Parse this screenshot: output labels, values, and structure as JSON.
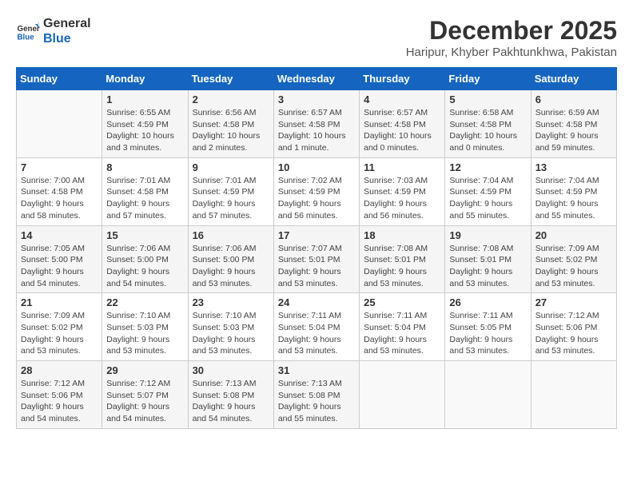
{
  "header": {
    "logo_line1": "General",
    "logo_line2": "Blue",
    "month_title": "December 2025",
    "location": "Haripur, Khyber Pakhtunkhwa, Pakistan"
  },
  "days_of_week": [
    "Sunday",
    "Monday",
    "Tuesday",
    "Wednesday",
    "Thursday",
    "Friday",
    "Saturday"
  ],
  "weeks": [
    [
      {
        "day": "",
        "detail": ""
      },
      {
        "day": "1",
        "detail": "Sunrise: 6:55 AM\nSunset: 4:59 PM\nDaylight: 10 hours\nand 3 minutes."
      },
      {
        "day": "2",
        "detail": "Sunrise: 6:56 AM\nSunset: 4:58 PM\nDaylight: 10 hours\nand 2 minutes."
      },
      {
        "day": "3",
        "detail": "Sunrise: 6:57 AM\nSunset: 4:58 PM\nDaylight: 10 hours\nand 1 minute."
      },
      {
        "day": "4",
        "detail": "Sunrise: 6:57 AM\nSunset: 4:58 PM\nDaylight: 10 hours\nand 0 minutes."
      },
      {
        "day": "5",
        "detail": "Sunrise: 6:58 AM\nSunset: 4:58 PM\nDaylight: 10 hours\nand 0 minutes."
      },
      {
        "day": "6",
        "detail": "Sunrise: 6:59 AM\nSunset: 4:58 PM\nDaylight: 9 hours\nand 59 minutes."
      }
    ],
    [
      {
        "day": "7",
        "detail": "Sunrise: 7:00 AM\nSunset: 4:58 PM\nDaylight: 9 hours\nand 58 minutes."
      },
      {
        "day": "8",
        "detail": "Sunrise: 7:01 AM\nSunset: 4:58 PM\nDaylight: 9 hours\nand 57 minutes."
      },
      {
        "day": "9",
        "detail": "Sunrise: 7:01 AM\nSunset: 4:59 PM\nDaylight: 9 hours\nand 57 minutes."
      },
      {
        "day": "10",
        "detail": "Sunrise: 7:02 AM\nSunset: 4:59 PM\nDaylight: 9 hours\nand 56 minutes."
      },
      {
        "day": "11",
        "detail": "Sunrise: 7:03 AM\nSunset: 4:59 PM\nDaylight: 9 hours\nand 56 minutes."
      },
      {
        "day": "12",
        "detail": "Sunrise: 7:04 AM\nSunset: 4:59 PM\nDaylight: 9 hours\nand 55 minutes."
      },
      {
        "day": "13",
        "detail": "Sunrise: 7:04 AM\nSunset: 4:59 PM\nDaylight: 9 hours\nand 55 minutes."
      }
    ],
    [
      {
        "day": "14",
        "detail": "Sunrise: 7:05 AM\nSunset: 5:00 PM\nDaylight: 9 hours\nand 54 minutes."
      },
      {
        "day": "15",
        "detail": "Sunrise: 7:06 AM\nSunset: 5:00 PM\nDaylight: 9 hours\nand 54 minutes."
      },
      {
        "day": "16",
        "detail": "Sunrise: 7:06 AM\nSunset: 5:00 PM\nDaylight: 9 hours\nand 53 minutes."
      },
      {
        "day": "17",
        "detail": "Sunrise: 7:07 AM\nSunset: 5:01 PM\nDaylight: 9 hours\nand 53 minutes."
      },
      {
        "day": "18",
        "detail": "Sunrise: 7:08 AM\nSunset: 5:01 PM\nDaylight: 9 hours\nand 53 minutes."
      },
      {
        "day": "19",
        "detail": "Sunrise: 7:08 AM\nSunset: 5:01 PM\nDaylight: 9 hours\nand 53 minutes."
      },
      {
        "day": "20",
        "detail": "Sunrise: 7:09 AM\nSunset: 5:02 PM\nDaylight: 9 hours\nand 53 minutes."
      }
    ],
    [
      {
        "day": "21",
        "detail": "Sunrise: 7:09 AM\nSunset: 5:02 PM\nDaylight: 9 hours\nand 53 minutes."
      },
      {
        "day": "22",
        "detail": "Sunrise: 7:10 AM\nSunset: 5:03 PM\nDaylight: 9 hours\nand 53 minutes."
      },
      {
        "day": "23",
        "detail": "Sunrise: 7:10 AM\nSunset: 5:03 PM\nDaylight: 9 hours\nand 53 minutes."
      },
      {
        "day": "24",
        "detail": "Sunrise: 7:11 AM\nSunset: 5:04 PM\nDaylight: 9 hours\nand 53 minutes."
      },
      {
        "day": "25",
        "detail": "Sunrise: 7:11 AM\nSunset: 5:04 PM\nDaylight: 9 hours\nand 53 minutes."
      },
      {
        "day": "26",
        "detail": "Sunrise: 7:11 AM\nSunset: 5:05 PM\nDaylight: 9 hours\nand 53 minutes."
      },
      {
        "day": "27",
        "detail": "Sunrise: 7:12 AM\nSunset: 5:06 PM\nDaylight: 9 hours\nand 53 minutes."
      }
    ],
    [
      {
        "day": "28",
        "detail": "Sunrise: 7:12 AM\nSunset: 5:06 PM\nDaylight: 9 hours\nand 54 minutes."
      },
      {
        "day": "29",
        "detail": "Sunrise: 7:12 AM\nSunset: 5:07 PM\nDaylight: 9 hours\nand 54 minutes."
      },
      {
        "day": "30",
        "detail": "Sunrise: 7:13 AM\nSunset: 5:08 PM\nDaylight: 9 hours\nand 54 minutes."
      },
      {
        "day": "31",
        "detail": "Sunrise: 7:13 AM\nSunset: 5:08 PM\nDaylight: 9 hours\nand 55 minutes."
      },
      {
        "day": "",
        "detail": ""
      },
      {
        "day": "",
        "detail": ""
      },
      {
        "day": "",
        "detail": ""
      }
    ]
  ]
}
